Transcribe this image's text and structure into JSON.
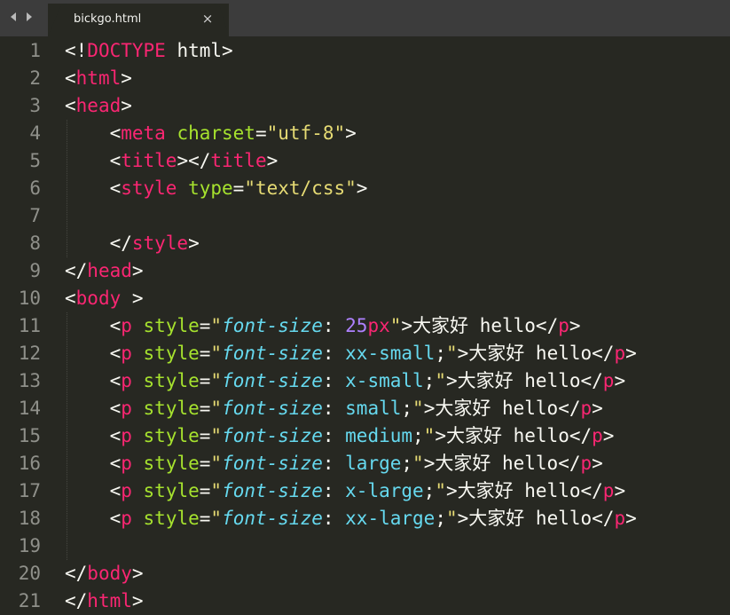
{
  "tab": {
    "title": "bickgo.html",
    "close_glyph": "×"
  },
  "nav": {
    "back_icon": "chevron-left-icon",
    "forward_icon": "chevron-right-icon"
  },
  "colors": {
    "background": "#272822",
    "tabbar": "#3c3c3c",
    "gutter": "#8f908a",
    "tag": "#f92672",
    "attribute": "#a6e22e",
    "string": "#e6db74",
    "property": "#66d9ef",
    "number": "#ae81ff",
    "text": "#f8f8f2"
  },
  "editor": {
    "lines": [
      {
        "number": "1",
        "tokens": [
          [
            "punc",
            "<!"
          ],
          [
            "tag",
            "DOCTYPE"
          ],
          [
            "punc",
            " html>"
          ]
        ]
      },
      {
        "number": "2",
        "tokens": [
          [
            "punc",
            "<"
          ],
          [
            "tag",
            "html"
          ],
          [
            "punc",
            ">"
          ]
        ]
      },
      {
        "number": "3",
        "tokens": [
          [
            "punc",
            "<"
          ],
          [
            "tag",
            "head"
          ],
          [
            "punc",
            ">"
          ]
        ]
      },
      {
        "number": "4",
        "tokens": [
          [
            "punc",
            "    <"
          ],
          [
            "tag",
            "meta"
          ],
          [
            "punc",
            " "
          ],
          [
            "attr",
            "charset"
          ],
          [
            "punc",
            "="
          ],
          [
            "str",
            "\"utf-8\""
          ],
          [
            "punc",
            ">"
          ]
        ]
      },
      {
        "number": "5",
        "tokens": [
          [
            "punc",
            "    <"
          ],
          [
            "tag",
            "title"
          ],
          [
            "punc",
            "></"
          ],
          [
            "tag",
            "title"
          ],
          [
            "punc",
            ">"
          ]
        ]
      },
      {
        "number": "6",
        "tokens": [
          [
            "punc",
            "    <"
          ],
          [
            "tag",
            "style"
          ],
          [
            "punc",
            " "
          ],
          [
            "attr",
            "type"
          ],
          [
            "punc",
            "="
          ],
          [
            "str",
            "\"text/css\""
          ],
          [
            "punc",
            ">"
          ]
        ]
      },
      {
        "number": "7",
        "tokens": []
      },
      {
        "number": "8",
        "tokens": [
          [
            "punc",
            "    </"
          ],
          [
            "tag",
            "style"
          ],
          [
            "punc",
            ">"
          ]
        ]
      },
      {
        "number": "9",
        "tokens": [
          [
            "punc",
            "</"
          ],
          [
            "tag",
            "head"
          ],
          [
            "punc",
            ">"
          ]
        ]
      },
      {
        "number": "10",
        "tokens": [
          [
            "punc",
            "<"
          ],
          [
            "tag",
            "body"
          ],
          [
            "punc",
            " >"
          ]
        ]
      },
      {
        "number": "11",
        "tokens": [
          [
            "punc",
            "    <"
          ],
          [
            "tag",
            "p"
          ],
          [
            "punc",
            " "
          ],
          [
            "attr",
            "style"
          ],
          [
            "punc",
            "="
          ],
          [
            "str",
            "\""
          ],
          [
            "prop",
            "font-size"
          ],
          [
            "punc",
            ": "
          ],
          [
            "num",
            "25"
          ],
          [
            "unit",
            "px"
          ],
          [
            "str",
            "\""
          ],
          [
            "punc",
            ">"
          ],
          [
            "text",
            "大家好 hello"
          ],
          [
            "punc",
            "</"
          ],
          [
            "tag",
            "p"
          ],
          [
            "punc",
            ">"
          ]
        ]
      },
      {
        "number": "12",
        "tokens": [
          [
            "punc",
            "    <"
          ],
          [
            "tag",
            "p"
          ],
          [
            "punc",
            " "
          ],
          [
            "attr",
            "style"
          ],
          [
            "punc",
            "="
          ],
          [
            "str",
            "\""
          ],
          [
            "prop",
            "font-size"
          ],
          [
            "punc",
            ": "
          ],
          [
            "val",
            "xx-small"
          ],
          [
            "punc",
            ";"
          ],
          [
            "str",
            "\""
          ],
          [
            "punc",
            ">"
          ],
          [
            "text",
            "大家好 hello"
          ],
          [
            "punc",
            "</"
          ],
          [
            "tag",
            "p"
          ],
          [
            "punc",
            ">"
          ]
        ]
      },
      {
        "number": "13",
        "tokens": [
          [
            "punc",
            "    <"
          ],
          [
            "tag",
            "p"
          ],
          [
            "punc",
            " "
          ],
          [
            "attr",
            "style"
          ],
          [
            "punc",
            "="
          ],
          [
            "str",
            "\""
          ],
          [
            "prop",
            "font-size"
          ],
          [
            "punc",
            ": "
          ],
          [
            "val",
            "x-small"
          ],
          [
            "punc",
            ";"
          ],
          [
            "str",
            "\""
          ],
          [
            "punc",
            ">"
          ],
          [
            "text",
            "大家好 hello"
          ],
          [
            "punc",
            "</"
          ],
          [
            "tag",
            "p"
          ],
          [
            "punc",
            ">"
          ]
        ]
      },
      {
        "number": "14",
        "tokens": [
          [
            "punc",
            "    <"
          ],
          [
            "tag",
            "p"
          ],
          [
            "punc",
            " "
          ],
          [
            "attr",
            "style"
          ],
          [
            "punc",
            "="
          ],
          [
            "str",
            "\""
          ],
          [
            "prop",
            "font-size"
          ],
          [
            "punc",
            ": "
          ],
          [
            "val",
            "small"
          ],
          [
            "punc",
            ";"
          ],
          [
            "str",
            "\""
          ],
          [
            "punc",
            ">"
          ],
          [
            "text",
            "大家好 hello"
          ],
          [
            "punc",
            "</"
          ],
          [
            "tag",
            "p"
          ],
          [
            "punc",
            ">"
          ]
        ]
      },
      {
        "number": "15",
        "tokens": [
          [
            "punc",
            "    <"
          ],
          [
            "tag",
            "p"
          ],
          [
            "punc",
            " "
          ],
          [
            "attr",
            "style"
          ],
          [
            "punc",
            "="
          ],
          [
            "str",
            "\""
          ],
          [
            "prop",
            "font-size"
          ],
          [
            "punc",
            ": "
          ],
          [
            "val",
            "medium"
          ],
          [
            "punc",
            ";"
          ],
          [
            "str",
            "\""
          ],
          [
            "punc",
            ">"
          ],
          [
            "text",
            "大家好 hello"
          ],
          [
            "punc",
            "</"
          ],
          [
            "tag",
            "p"
          ],
          [
            "punc",
            ">"
          ]
        ]
      },
      {
        "number": "16",
        "tokens": [
          [
            "punc",
            "    <"
          ],
          [
            "tag",
            "p"
          ],
          [
            "punc",
            " "
          ],
          [
            "attr",
            "style"
          ],
          [
            "punc",
            "="
          ],
          [
            "str",
            "\""
          ],
          [
            "prop",
            "font-size"
          ],
          [
            "punc",
            ": "
          ],
          [
            "val",
            "large"
          ],
          [
            "punc",
            ";"
          ],
          [
            "str",
            "\""
          ],
          [
            "punc",
            ">"
          ],
          [
            "text",
            "大家好 hello"
          ],
          [
            "punc",
            "</"
          ],
          [
            "tag",
            "p"
          ],
          [
            "punc",
            ">"
          ]
        ]
      },
      {
        "number": "17",
        "tokens": [
          [
            "punc",
            "    <"
          ],
          [
            "tag",
            "p"
          ],
          [
            "punc",
            " "
          ],
          [
            "attr",
            "style"
          ],
          [
            "punc",
            "="
          ],
          [
            "str",
            "\""
          ],
          [
            "prop",
            "font-size"
          ],
          [
            "punc",
            ": "
          ],
          [
            "val",
            "x-large"
          ],
          [
            "punc",
            ";"
          ],
          [
            "str",
            "\""
          ],
          [
            "punc",
            ">"
          ],
          [
            "text",
            "大家好 hello"
          ],
          [
            "punc",
            "</"
          ],
          [
            "tag",
            "p"
          ],
          [
            "punc",
            ">"
          ]
        ]
      },
      {
        "number": "18",
        "tokens": [
          [
            "punc",
            "    <"
          ],
          [
            "tag",
            "p"
          ],
          [
            "punc",
            " "
          ],
          [
            "attr",
            "style"
          ],
          [
            "punc",
            "="
          ],
          [
            "str",
            "\""
          ],
          [
            "prop",
            "font-size"
          ],
          [
            "punc",
            ": "
          ],
          [
            "val",
            "xx-large"
          ],
          [
            "punc",
            ";"
          ],
          [
            "str",
            "\""
          ],
          [
            "punc",
            ">"
          ],
          [
            "text",
            "大家好 hello"
          ],
          [
            "punc",
            "</"
          ],
          [
            "tag",
            "p"
          ],
          [
            "punc",
            ">"
          ]
        ]
      },
      {
        "number": "19",
        "tokens": []
      },
      {
        "number": "20",
        "tokens": [
          [
            "punc",
            "</"
          ],
          [
            "tag",
            "body"
          ],
          [
            "punc",
            ">"
          ]
        ]
      },
      {
        "number": "21",
        "tokens": [
          [
            "punc",
            "</"
          ],
          [
            "tag",
            "html"
          ],
          [
            "punc",
            ">"
          ]
        ]
      }
    ]
  }
}
